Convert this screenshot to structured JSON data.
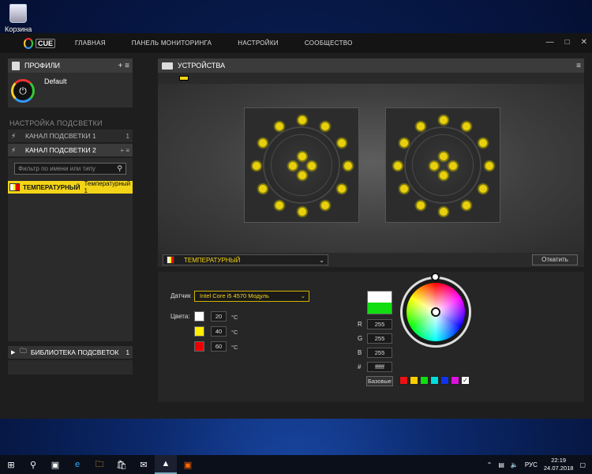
{
  "desktop": {
    "recycle_bin_label": "Корзина"
  },
  "app": {
    "logo_text": "CUE",
    "nav": [
      "ГЛАВНАЯ",
      "ПАНЕЛЬ МОНИТОРИНГА",
      "НАСТРОЙКИ",
      "СООБЩЕСТВО"
    ]
  },
  "left": {
    "profiles_header": "ПРОФИЛИ",
    "profile_name": "Default",
    "lighting_section": "НАСТРОЙКА ПОДСВЕТКИ",
    "channels": [
      {
        "label": "КАНАЛ ПОДСВЕТКИ 1",
        "count": "1"
      },
      {
        "label": "КАНАЛ ПОДСВЕТКИ 2",
        "count": ""
      }
    ],
    "filter_placeholder": "Фильтр по имени или типу",
    "effect_item": {
      "type": "ТЕМПЕРАТУРНЫЙ",
      "name": "Температурный 1"
    },
    "library": {
      "label": "БИБЛИОТЕКА ПОДСВЕТОК",
      "count": "1"
    }
  },
  "devices": {
    "header": "УСТРОЙСТВА"
  },
  "effect": {
    "selected": "ТЕМПЕРАТУРНЫЙ",
    "revert_label": "Откатить",
    "sensor_label": "Датчик",
    "sensor_value": "Intel Core i5 4570 Модуль",
    "colors_label": "Цвета:",
    "color_stops": [
      {
        "color": "#ffffff",
        "temp": "20",
        "unit": "°C"
      },
      {
        "color": "#ffee00",
        "temp": "40",
        "unit": "°C"
      },
      {
        "color": "#ee0000",
        "temp": "60",
        "unit": "°C"
      }
    ],
    "rgb": {
      "r_label": "R",
      "g_label": "G",
      "b_label": "B",
      "hex_label": "#",
      "r": "255",
      "g": "255",
      "b": "255",
      "hex": "ffffff"
    },
    "base_button": "Базовые",
    "palette": [
      "#ee1111",
      "#ffcc00",
      "#11dd11",
      "#00dddd",
      "#1133ee",
      "#dd11dd",
      "#ffffff"
    ]
  },
  "taskbar": {
    "lang": "РУС",
    "time": "22:19",
    "date": "24.07.2018"
  }
}
